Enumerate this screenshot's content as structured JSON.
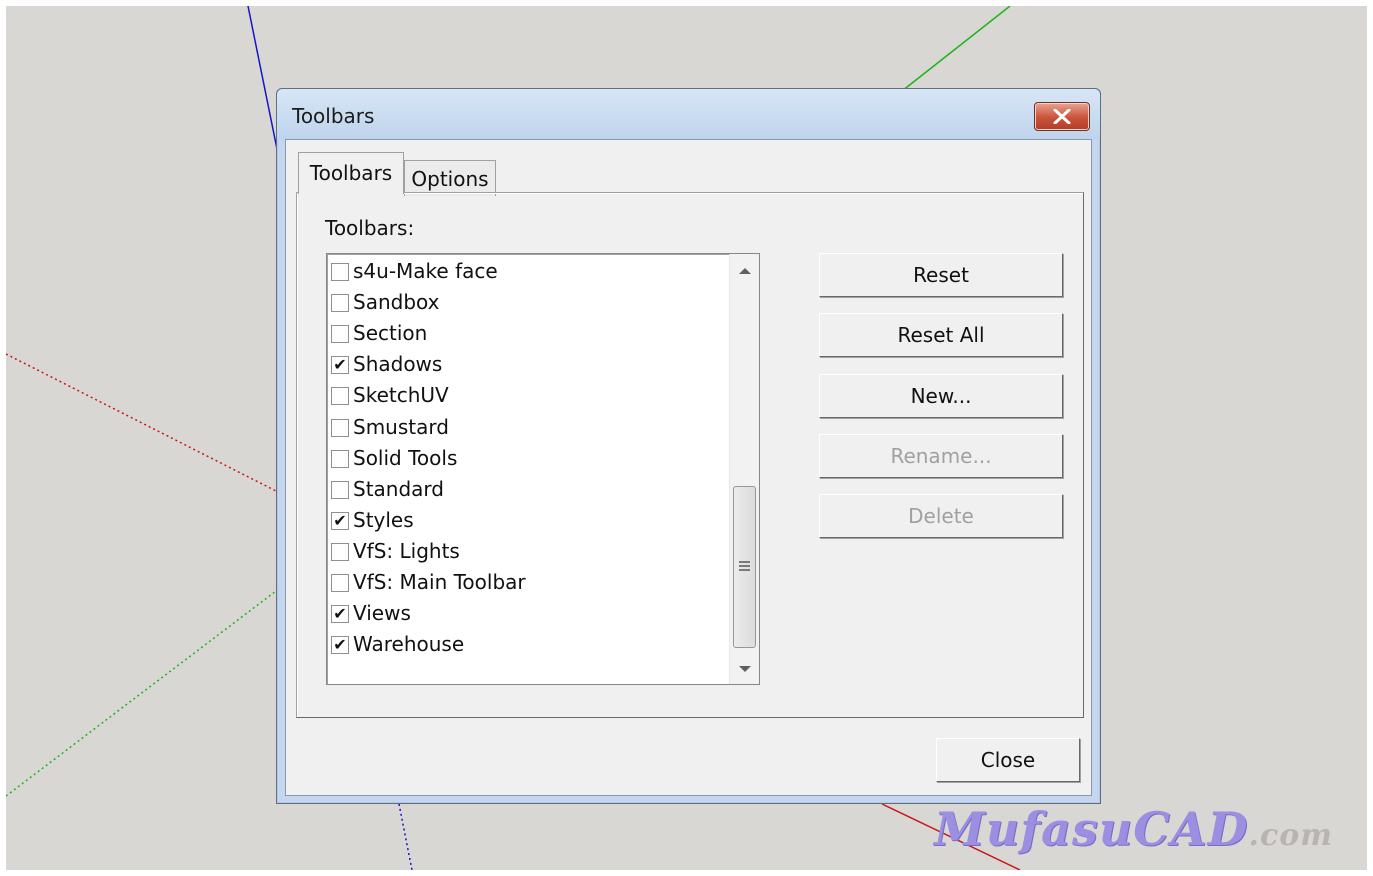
{
  "dialog": {
    "title": "Toolbars",
    "tabs": [
      {
        "label": "Toolbars",
        "selected": true
      },
      {
        "label": "Options",
        "selected": false
      }
    ],
    "list_label": "Toolbars:",
    "items": [
      {
        "label": "s4u-Make face",
        "checked": false
      },
      {
        "label": "Sandbox",
        "checked": false
      },
      {
        "label": "Section",
        "checked": false
      },
      {
        "label": "Shadows",
        "checked": true
      },
      {
        "label": "SketchUV",
        "checked": false
      },
      {
        "label": "Smustard",
        "checked": false
      },
      {
        "label": "Solid Tools",
        "checked": false
      },
      {
        "label": "Standard",
        "checked": false
      },
      {
        "label": "Styles",
        "checked": true
      },
      {
        "label": "VfS: Lights",
        "checked": false
      },
      {
        "label": "VfS: Main Toolbar",
        "checked": false
      },
      {
        "label": "Views",
        "checked": true
      },
      {
        "label": "Warehouse",
        "checked": true
      }
    ],
    "buttons": {
      "reset": {
        "label": "Reset",
        "enabled": true
      },
      "reset_all": {
        "label": "Reset All",
        "enabled": true
      },
      "new": {
        "label": "New...",
        "enabled": true
      },
      "rename": {
        "label": "Rename...",
        "enabled": false
      },
      "delete": {
        "label": "Delete",
        "enabled": false
      },
      "close": {
        "label": "Close",
        "enabled": true
      }
    },
    "close_icon": "close-x-icon"
  },
  "watermark": {
    "brand": "MufasuCAD",
    "suffix": ".com"
  },
  "colors": {
    "axis_red": "#c8151a",
    "axis_green": "#1db41a",
    "axis_blue": "#1414c8",
    "viewport_bg": "#d8d7d3",
    "dialog_frame": "#c4d7ee",
    "close_button": "#c9523b"
  }
}
